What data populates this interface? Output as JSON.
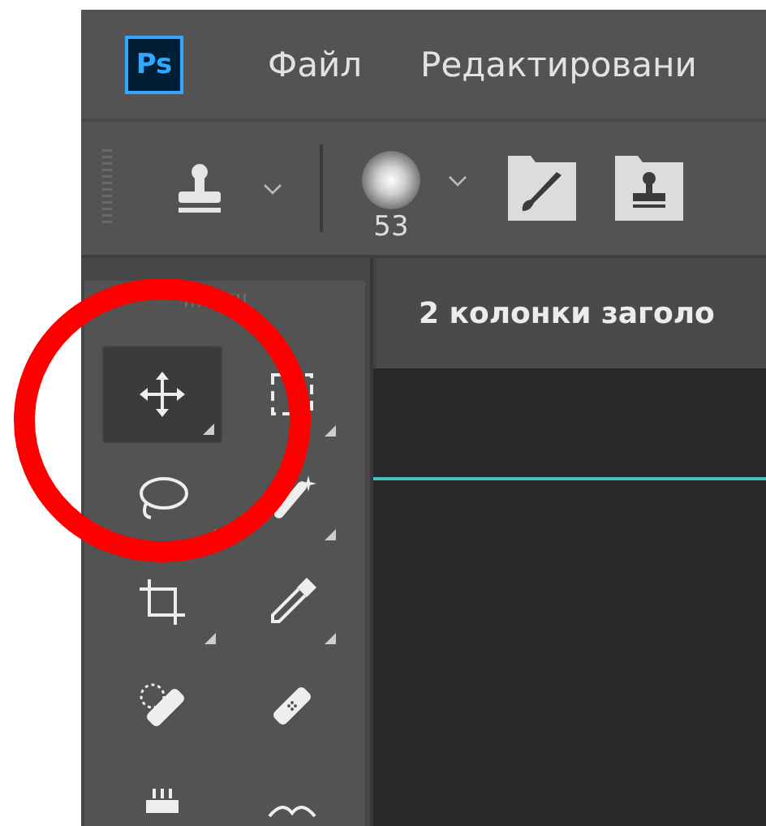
{
  "app_logo": {
    "text": "Ps"
  },
  "menu": {
    "items": [
      {
        "label": "Файл"
      },
      {
        "label": "Редактировани"
      }
    ]
  },
  "options_bar": {
    "brush_size": "53"
  },
  "tools_panel": {
    "tools": [
      {
        "kind": "move",
        "selected": true
      },
      {
        "kind": "marquee",
        "selected": false
      },
      {
        "kind": "lasso",
        "selected": false
      },
      {
        "kind": "wand",
        "selected": false
      },
      {
        "kind": "crop",
        "selected": false
      },
      {
        "kind": "eyedropper",
        "selected": false
      },
      {
        "kind": "healing",
        "selected": false
      },
      {
        "kind": "bandage",
        "selected": false
      },
      {
        "kind": "stamp",
        "selected": false
      },
      {
        "kind": "curve",
        "selected": false
      }
    ]
  },
  "document": {
    "tab_title": "2 колонки заголо"
  },
  "annotation": {
    "kind": "circle",
    "color": "#ff0000"
  }
}
